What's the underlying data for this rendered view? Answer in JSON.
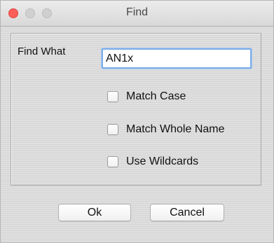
{
  "window": {
    "title": "Find"
  },
  "find": {
    "label": "Find What",
    "value": "AN1x"
  },
  "options": [
    {
      "label": "Match Case",
      "checked": false
    },
    {
      "label": "Match Whole Name",
      "checked": false
    },
    {
      "label": "Use Wildcards",
      "checked": false
    }
  ],
  "buttons": {
    "ok_label": "Ok",
    "cancel_label": "Cancel"
  },
  "colors": {
    "close_button": "#fc5f57",
    "focus_ring": "#7eaee8"
  }
}
